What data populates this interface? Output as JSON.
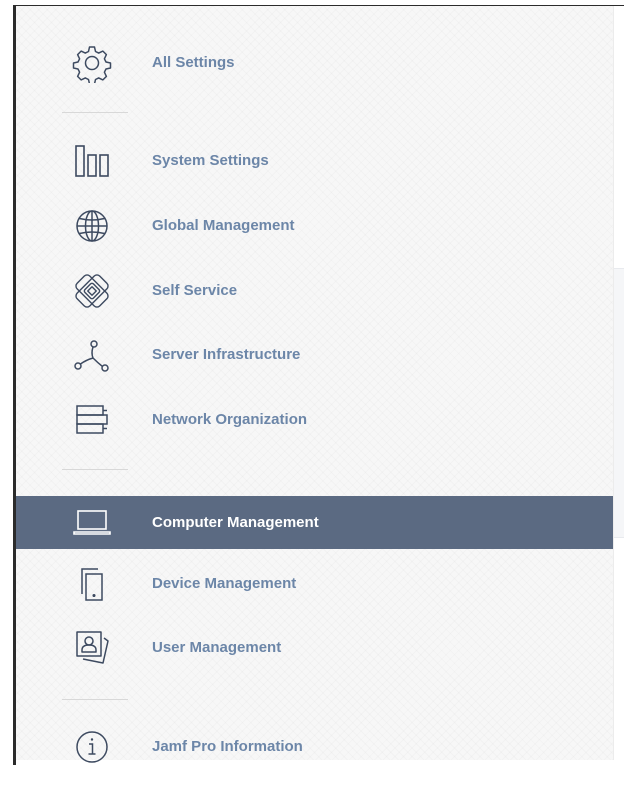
{
  "colors": {
    "label": "#6c86a8",
    "icon": "#3d4a60",
    "active_background": "#5b6a82",
    "active_label": "#ffffff"
  },
  "sidebar": {
    "items": [
      {
        "label": "All Settings",
        "icon": "gear-icon"
      },
      {
        "label": "System Settings",
        "icon": "columns-icon"
      },
      {
        "label": "Global Management",
        "icon": "globe-icon"
      },
      {
        "label": "Self Service",
        "icon": "self-service-icon"
      },
      {
        "label": "Server Infrastructure",
        "icon": "nodes-icon"
      },
      {
        "label": "Network Organization",
        "icon": "stack-icon"
      },
      {
        "label": "Computer Management",
        "icon": "laptop-icon",
        "active": true
      },
      {
        "label": "Device Management",
        "icon": "mobile-device-icon"
      },
      {
        "label": "User Management",
        "icon": "user-card-icon"
      },
      {
        "label": "Jamf Pro Information",
        "icon": "info-icon"
      }
    ]
  }
}
